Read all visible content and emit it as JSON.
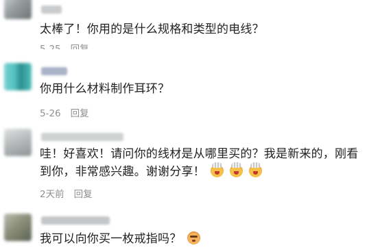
{
  "comments": [
    {
      "text": "太棒了！你用的是什么规格和类型的电线？",
      "date": "5-25",
      "reply": "回复",
      "avatar_colors": [
        "#9aa0a2",
        "#6d7274",
        "#d7d9da"
      ],
      "name_color": "#c9cbcd"
    },
    {
      "text": "你用什么材料制作耳环？",
      "date": "5-26",
      "reply": "回复",
      "avatar_colors": [
        "#4fc0bd",
        "#7bd1cf",
        "#2c8e91"
      ],
      "name_color": "#aab4c8"
    },
    {
      "text_line1": "哇！好喜欢！请问你的线材是从哪里买的？我是新来的，刚看",
      "text_line2": "到你，非常感兴趣。谢谢分享！",
      "date": "2天前",
      "reply": "回复",
      "emoji_icon": "exploding-head-emoji",
      "avatar_colors": [
        "#b8bcbd",
        "#8e9395",
        "#e0e2e3"
      ],
      "name_color": "#d0d2d4"
    },
    {
      "text": "我可以向你买一枚戒指吗？",
      "emoji_icon": "flushed-face-emoji",
      "avatar_colors": [
        "#8b8f7a",
        "#5c6152",
        "#b9bcae"
      ],
      "name_color": "#c4c6c8"
    }
  ]
}
